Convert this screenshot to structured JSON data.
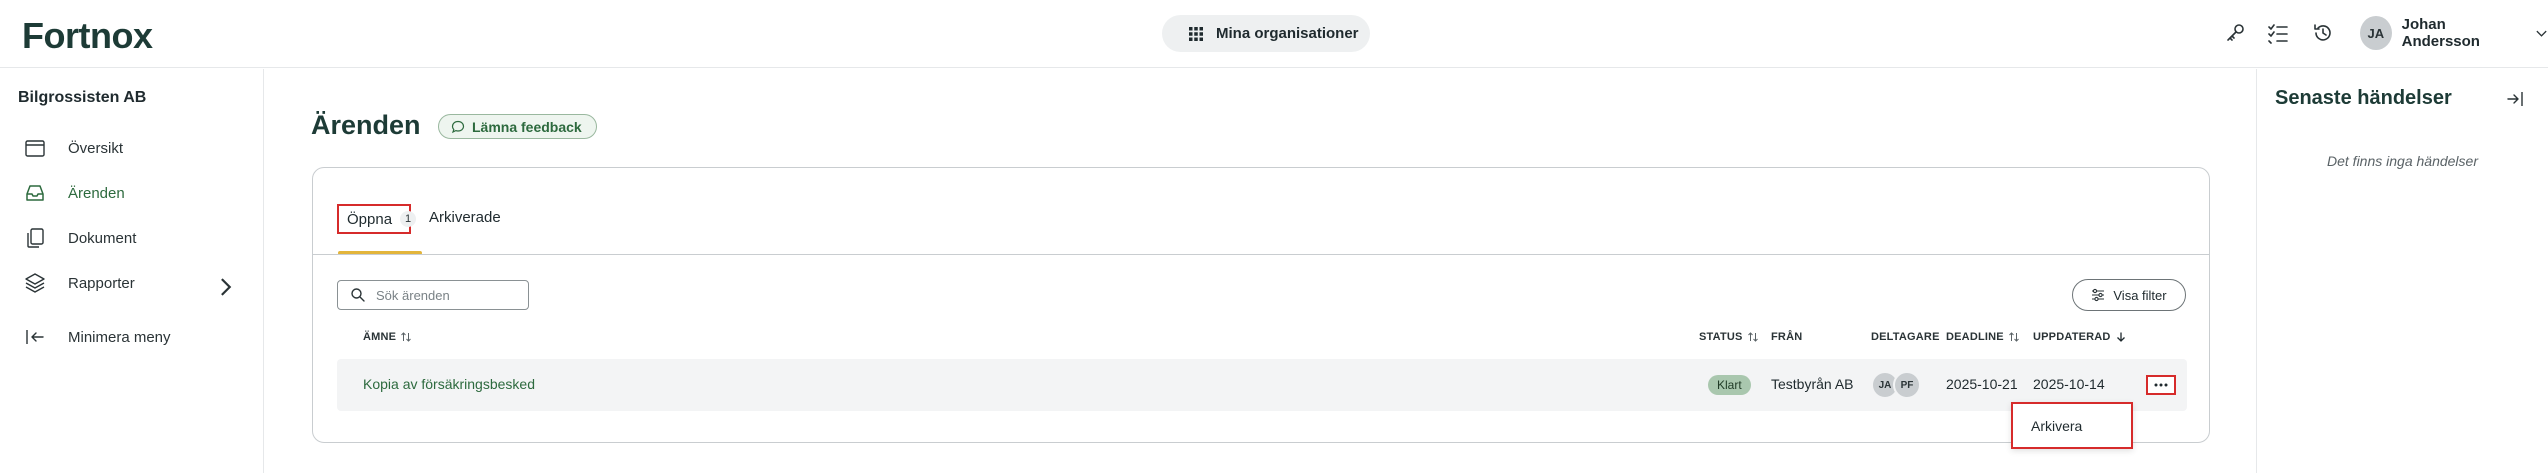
{
  "header": {
    "logo": "Fortnox",
    "org_button": "Mina organisationer",
    "user": {
      "initials": "JA",
      "name": "Johan Andersson"
    }
  },
  "sidebar": {
    "company": "Bilgrossisten AB",
    "items": [
      {
        "label": "Översikt",
        "icon": "calendar-icon"
      },
      {
        "label": "Ärenden",
        "icon": "inbox-icon",
        "active": true
      },
      {
        "label": "Dokument",
        "icon": "documents-icon"
      },
      {
        "label": "Rapporter",
        "icon": "layers-icon"
      },
      {
        "label": "Minimera meny",
        "icon": "collapse-left-icon"
      }
    ]
  },
  "main": {
    "title": "Ärenden",
    "feedback_label": "Lämna feedback",
    "tabs": [
      {
        "label": "Öppna",
        "count": "1",
        "active": true
      },
      {
        "label": "Arkiverade"
      }
    ],
    "search": {
      "placeholder": "Sök ärenden",
      "value": ""
    },
    "filter_label": "Visa filter",
    "columns": {
      "subject": "ÄMNE",
      "status": "STATUS",
      "from": "FRÅN",
      "participants": "DELTAGARE",
      "deadline": "DEADLINE",
      "updated": "UPPDATERAD"
    },
    "rows": [
      {
        "subject": "Kopia av försäkringsbesked",
        "status": "Klart",
        "from": "Testbyrån AB",
        "participants": [
          "JA",
          "PF"
        ],
        "deadline": "2025-10-21",
        "updated": "2025-10-14"
      }
    ],
    "row_menu": {
      "items": [
        "Arkivera"
      ]
    }
  },
  "right_panel": {
    "title": "Senaste händelser",
    "empty_text": "Det finns inga händelser"
  },
  "colors": {
    "brand_dark": "#1d3b36",
    "active_green": "#2d6a3e",
    "tab_underline": "#e3b53b",
    "highlight_red": "#d62b2b",
    "status_green": "#a9c7ae"
  }
}
